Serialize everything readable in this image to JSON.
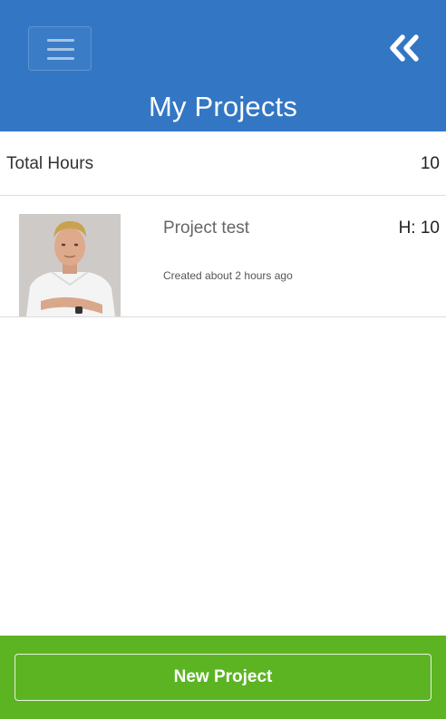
{
  "header": {
    "title": "My Projects",
    "menu_icon": "hamburger-menu-icon",
    "back_icon": "double-chevron-left-icon",
    "background_color": "#3377c4"
  },
  "summary": {
    "total_label": "Total Hours",
    "total_value": "10"
  },
  "projects": [
    {
      "name": "Project test",
      "hours": "H: 10",
      "created": "Created about 2 hours ago",
      "thumbnail": "user-photo"
    }
  ],
  "footer": {
    "new_project_label": "New Project",
    "background_color": "#5cb423"
  }
}
